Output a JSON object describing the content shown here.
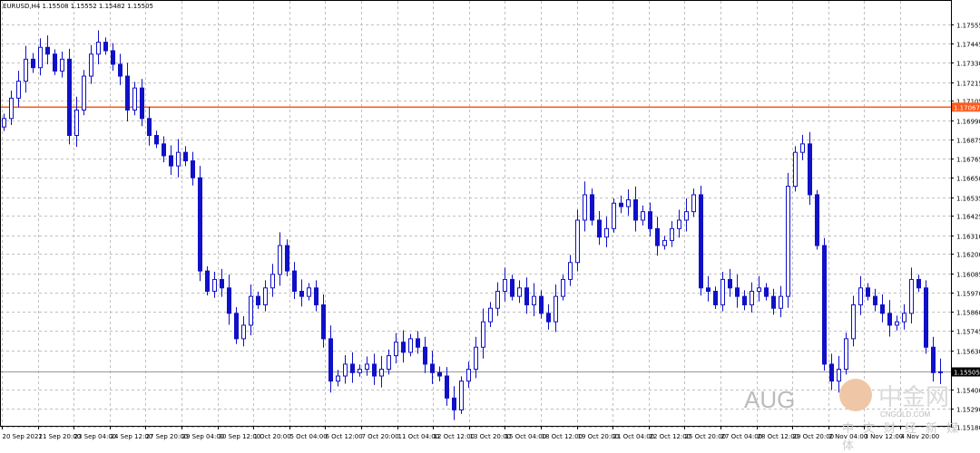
{
  "header": {
    "symbol": "EURUSD,H4",
    "ohlc": "1.15508 1.15552 1.15482 1.15505"
  },
  "watermark": {
    "brand": "AUG",
    "logo_text": "中金网",
    "logo_sub": "CNGOLD.COM",
    "logo_tagline": "中文财经新媒体"
  },
  "colors": {
    "candle": "#1010c8",
    "grid": "#c0c0c0",
    "hline": "#ff5a1a",
    "axis": "#000000"
  },
  "chart_data": {
    "type": "candlestick",
    "title": "EURUSD,H4",
    "ylim": [
      1.1514,
      1.1769
    ],
    "y_ticks": [
      "1.17555",
      "1.17445",
      "1.17330",
      "1.17215",
      "1.17105",
      "1.16990",
      "1.16875",
      "1.16765",
      "1.16650",
      "1.16535",
      "1.16425",
      "1.16310",
      "1.16200",
      "1.16085",
      "1.15970",
      "1.15860",
      "1.15745",
      "1.15630",
      "1.15400",
      "1.15290",
      "1.15180"
    ],
    "x_ticks": [
      "20 Sep 2021",
      "21 Sep 20:00",
      "23 Sep 04:00",
      "24 Sep 12:00",
      "27 Sep 20:00",
      "29 Sep 04:00",
      "30 Sep 12:00",
      "1 Oct 20:00",
      "5 Oct 04:00",
      "6 Oct 12:00",
      "7 Oct 20:00",
      "11 Oct 04:00",
      "12 Oct 12:00",
      "13 Oct 20:00",
      "15 Oct 04:00",
      "18 Oct 12:00",
      "19 Oct 20:00",
      "21 Oct 04:00",
      "22 Oct 12:00",
      "25 Oct 20:00",
      "27 Oct 04:00",
      "28 Oct 12:00",
      "29 Oct 20:00",
      "2 Nov 04:00",
      "3 Nov 12:00",
      "4 Nov 20:00"
    ],
    "horizontal_line": {
      "value": 1.17067,
      "label": "1.17067"
    },
    "current_price": {
      "value": 1.15505,
      "label": "1.15505"
    },
    "closes": [
      1.17,
      1.1712,
      1.1722,
      1.1735,
      1.173,
      1.1742,
      1.1738,
      1.1728,
      1.1735,
      1.169,
      1.1705,
      1.1725,
      1.1738,
      1.1745,
      1.174,
      1.1732,
      1.1725,
      1.1705,
      1.1718,
      1.17,
      1.169,
      1.1685,
      1.1678,
      1.1672,
      1.168,
      1.1675,
      1.1665,
      1.161,
      1.1598,
      1.1605,
      1.16,
      1.1585,
      1.157,
      1.1578,
      1.1595,
      1.159,
      1.16,
      1.1608,
      1.1625,
      1.161,
      1.1598,
      1.1595,
      1.16,
      1.159,
      1.157,
      1.1545,
      1.1548,
      1.1555,
      1.155,
      1.1552,
      1.1555,
      1.1548,
      1.1552,
      1.156,
      1.1568,
      1.1562,
      1.157,
      1.1565,
      1.1555,
      1.155,
      1.1548,
      1.1535,
      1.1528,
      1.1545,
      1.1552,
      1.1565,
      1.158,
      1.1588,
      1.1598,
      1.1605,
      1.1595,
      1.16,
      1.159,
      1.1595,
      1.1585,
      1.158,
      1.1595,
      1.1605,
      1.1615,
      1.164,
      1.1655,
      1.164,
      1.163,
      1.1635,
      1.165,
      1.1648,
      1.1652,
      1.164,
      1.1645,
      1.1635,
      1.1625,
      1.1628,
      1.1635,
      1.164,
      1.1645,
      1.1655,
      1.16,
      1.1598,
      1.159,
      1.1605,
      1.16,
      1.1595,
      1.159,
      1.1598,
      1.16,
      1.1595,
      1.1588,
      1.1595,
      1.166,
      1.168,
      1.1685,
      1.1655,
      1.1625,
      1.1555,
      1.1545,
      1.1552,
      1.157,
      1.159,
      1.16,
      1.1595,
      1.159,
      1.1585,
      1.1578,
      1.158,
      1.1585,
      1.1605,
      1.16,
      1.1565,
      1.155,
      1.15505
    ],
    "first_open": 1.1695
  }
}
